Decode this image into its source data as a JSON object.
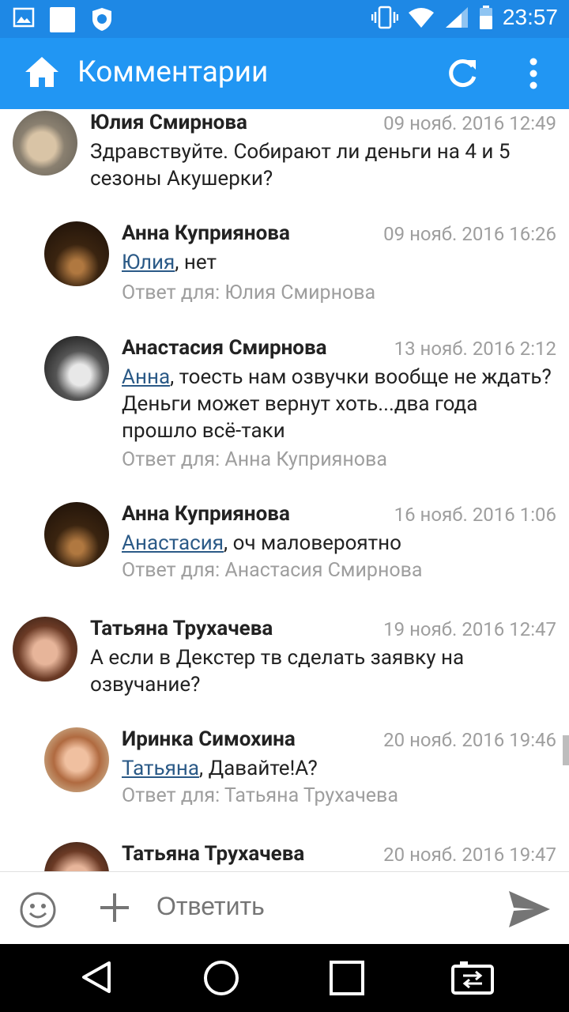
{
  "status": {
    "time": "23:57"
  },
  "header": {
    "title": "Комментарии"
  },
  "comments": [
    {
      "author": "Юлия Смирнова",
      "date": "09 нояб. 2016 12:49",
      "mention": "",
      "text": "Здравствуйте. Собирают ли деньги на 4 и 5 сезоны Акушерки?",
      "reply_to": ""
    },
    {
      "author": "Анна Куприянова",
      "date": "09 нояб. 2016 16:26",
      "mention": "Юлия",
      "text": ", нет",
      "reply_to": "Ответ для: Юлия Смирнова"
    },
    {
      "author": "Анастасия Смирнова",
      "date": "13 нояб. 2016 2:12",
      "mention": "Анна",
      "text": ", тоесть нам озвучки вообще не ждать? Деньги может вернут хоть...два года прошло всё-таки",
      "reply_to": "Ответ для: Анна Куприянова"
    },
    {
      "author": "Анна Куприянова",
      "date": "16 нояб. 2016 1:06",
      "mention": "Анастасия",
      "text": ", оч маловероятно",
      "reply_to": "Ответ для: Анастасия Смирнова"
    },
    {
      "author": "Татьяна Трухачева",
      "date": "19 нояб. 2016 12:47",
      "mention": "",
      "text": "А если в Декстер тв сделать заявку на озвучание?",
      "reply_to": ""
    },
    {
      "author": "Иринка Симохина",
      "date": "20 нояб. 2016 19:46",
      "mention": "Татьяна",
      "text": ", Давайте!А?",
      "reply_to": "Ответ для: Татьяна Трухачева"
    },
    {
      "author": "Татьяна Трухачева",
      "date": "20 нояб. 2016 19:47",
      "mention": "",
      "text": "",
      "reply_to": ""
    }
  ],
  "input": {
    "placeholder": "Ответить"
  },
  "icons": {
    "home": "home-icon",
    "refresh": "refresh-icon",
    "more": "more-vert-icon",
    "emoji": "emoji-icon",
    "add": "plus-icon",
    "send": "send-icon",
    "back": "back-icon",
    "home_nav": "home-nav-icon",
    "recents": "recents-icon",
    "switch": "switch-icon"
  },
  "colors": {
    "status_bar": "#1e88e5",
    "app_bar": "#2196f3",
    "mention": "#2b5a87",
    "secondary_text": "#9e9e9e"
  }
}
